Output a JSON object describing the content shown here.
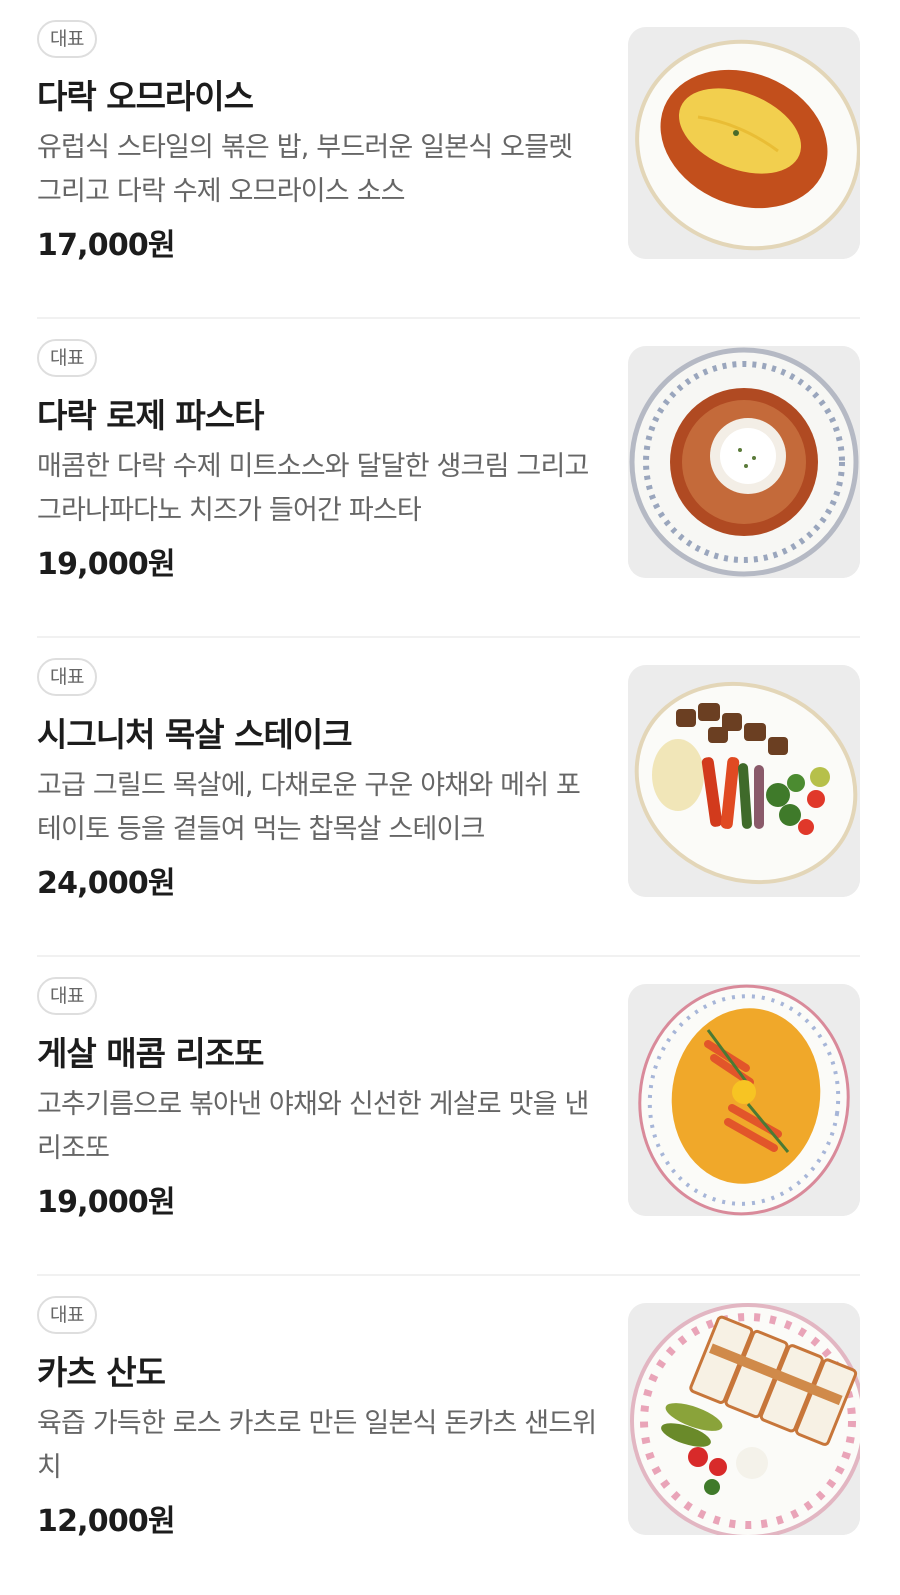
{
  "items": [
    {
      "badge": "대표",
      "name": "다락 오므라이스",
      "description": "유럽식 스타일의 볶은 밥, 부드러운 일본식 오믈렛 그리고 다락 수제 오므라이스 소스",
      "price": "17,000원",
      "image": "omurice-photo"
    },
    {
      "badge": "대표",
      "name": "다락 로제 파스타",
      "description": "매콤한 다락 수제 미트소스와 달달한 생크림 그리고 그라나파다노 치즈가 들어간 파스타",
      "price": "19,000원",
      "image": "rose-pasta-photo"
    },
    {
      "badge": "대표",
      "name": "시그니처 목살 스테이크",
      "description": "고급 그릴드 목살에, 다채로운 구운 야채와 메쉬 포테이토 등을 곁들여 먹는 찹목살 스테이크",
      "price": "24,000원",
      "image": "pork-neck-steak-photo"
    },
    {
      "badge": "대표",
      "name": "게살 매콤 리조또",
      "description": "고추기름으로 볶아낸 야채와 신선한 게살로 맛을 낸 리조또",
      "price": "19,000원",
      "image": "crab-risotto-photo"
    },
    {
      "badge": "대표",
      "name": "카츠 산도",
      "description": "육즙 가득한 로스 카츠로 만든 일본식 돈카츠 샌드위치",
      "price": "12,000원",
      "image": "katsu-sando-photo"
    }
  ]
}
